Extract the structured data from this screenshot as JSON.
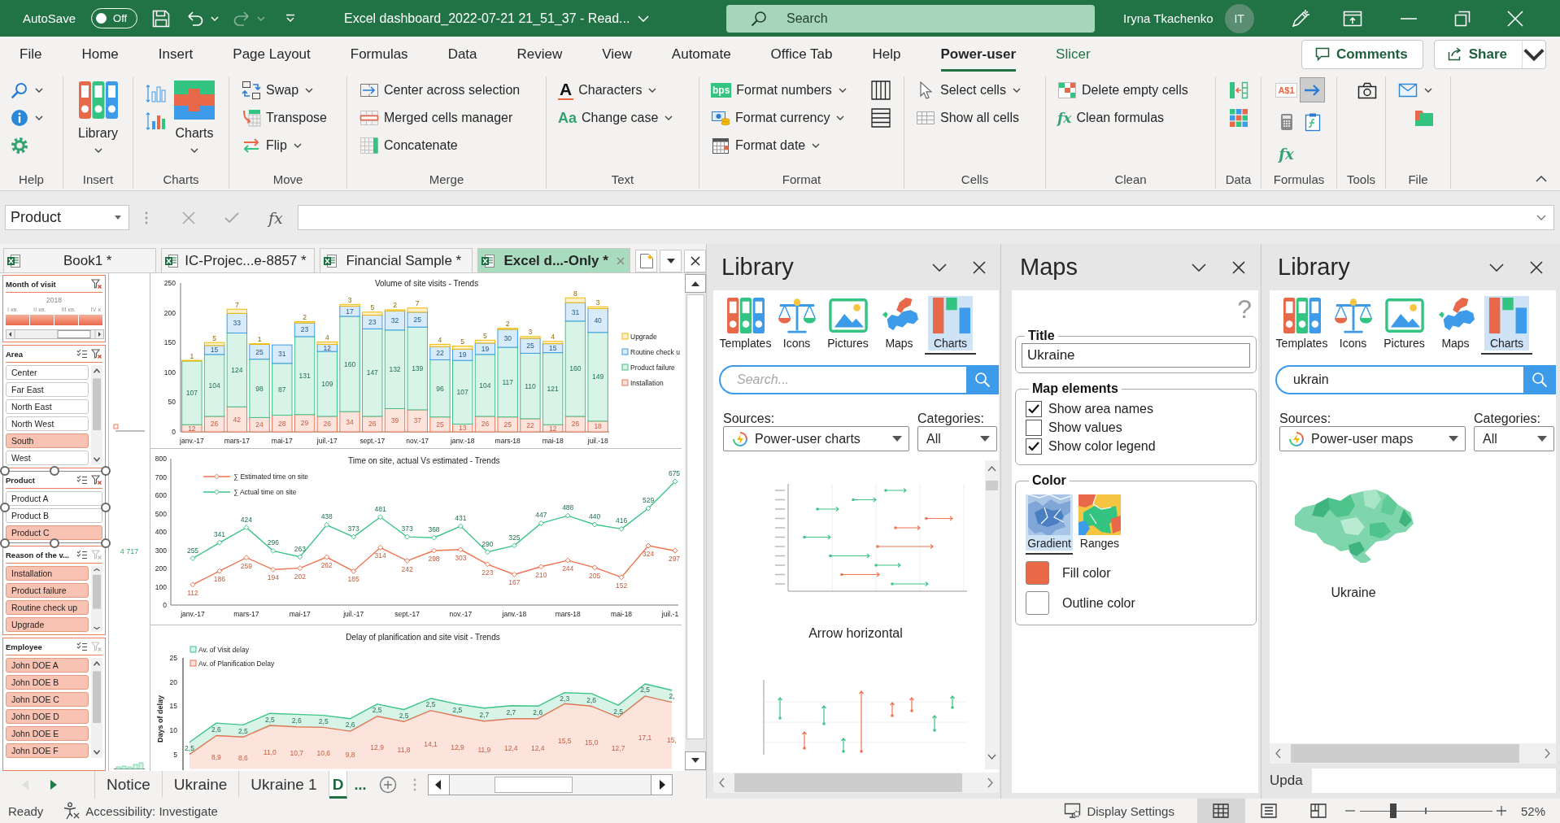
{
  "title_bar": {
    "autosave": {
      "label": "AutoSave",
      "state_label": "Off",
      "on": false
    },
    "redo": {
      "disabled": true
    },
    "document_title": "Excel dashboard_2022-07-21 21_51_37 - Read...",
    "search": {
      "placeholder": "Search"
    },
    "user": {
      "name": "Iryna Tkachenko",
      "initials": "IT"
    }
  },
  "ribbon": {
    "tabs": [
      {
        "label": "File",
        "selected": false,
        "kind": "tab"
      },
      {
        "label": "Home",
        "selected": false,
        "kind": "tab"
      },
      {
        "label": "Insert",
        "selected": false,
        "kind": "tab"
      },
      {
        "label": "Page Layout",
        "selected": false,
        "kind": "tab"
      },
      {
        "label": "Formulas",
        "selected": false,
        "kind": "tab"
      },
      {
        "label": "Data",
        "selected": false,
        "kind": "tab"
      },
      {
        "label": "Review",
        "selected": false,
        "kind": "tab"
      },
      {
        "label": "View",
        "selected": false,
        "kind": "tab"
      },
      {
        "label": "Automate",
        "selected": false,
        "kind": "tab"
      },
      {
        "label": "Office Tab",
        "selected": false,
        "kind": "tab"
      },
      {
        "label": "Help",
        "selected": false,
        "kind": "tab"
      },
      {
        "label": "Power-user",
        "selected": true,
        "kind": "tab"
      },
      {
        "label": "Slicer",
        "selected": false,
        "kind": "contextual"
      }
    ],
    "actions": [
      {
        "label": "Comments"
      },
      {
        "label": "Share"
      }
    ],
    "groups": [
      {
        "label": "Help"
      },
      {
        "label": "Insert",
        "buttons": [
          {
            "label": "Library"
          }
        ]
      },
      {
        "label": "Charts",
        "buttons": [
          {
            "label": "Charts"
          }
        ]
      },
      {
        "label": "Move",
        "buttons": [
          {
            "label": "Swap"
          },
          {
            "label": "Transpose"
          },
          {
            "label": "Flip"
          }
        ]
      },
      {
        "label": "Merge",
        "buttons": [
          {
            "label": "Center across selection"
          },
          {
            "label": "Merged cells manager"
          },
          {
            "label": "Concatenate"
          }
        ]
      },
      {
        "label": "Text",
        "buttons": [
          {
            "label": "Characters",
            "glyph": "A"
          },
          {
            "label": "Change case",
            "glyph": "Aa"
          }
        ]
      },
      {
        "label": "Format",
        "buttons": [
          {
            "label": "Format numbers",
            "glyph": "bps"
          },
          {
            "label": "Format currency"
          },
          {
            "label": "Format date"
          }
        ]
      },
      {
        "label": "Cells",
        "buttons": [
          {
            "label": "Select cells"
          },
          {
            "label": "Show all cells"
          }
        ]
      },
      {
        "label": "Clean",
        "buttons": [
          {
            "label": "Delete empty cells"
          },
          {
            "label": "Clean formulas",
            "glyph": "fx"
          }
        ]
      },
      {
        "label": "Data"
      },
      {
        "label": "Formulas",
        "buttons": [
          {
            "glyph": "A$1",
            "pressed": false
          },
          {
            "pressed": true
          },
          {
            "pressed": false
          },
          {
            "pressed": false
          },
          {
            "glyph": "fx",
            "pressed": false
          }
        ]
      },
      {
        "label": "Tools"
      },
      {
        "label": "File"
      }
    ]
  },
  "formula_bar": {
    "name_box": "Product",
    "fx": "fx"
  },
  "workbook_tabs": [
    {
      "label": "Book1 *",
      "selected": false
    },
    {
      "label": "IC-Projec...e-8857 *",
      "selected": false
    },
    {
      "label": "Financial Sample *",
      "selected": false
    },
    {
      "label": "Excel d...-Only *",
      "selected": true
    }
  ],
  "sheet": {
    "slicers": [
      {
        "kind": "timeline",
        "title": "Month of visit",
        "filtered": true,
        "selected": false,
        "year": "2018",
        "periods": [
          "I кв.",
          "II кв.",
          "III кв.",
          "IV к"
        ]
      },
      {
        "kind": "list",
        "title": "Area",
        "filtered": true,
        "selected": false,
        "items": [
          {
            "label": "Center",
            "selected": false
          },
          {
            "label": "Far East",
            "selected": false
          },
          {
            "label": "North East",
            "selected": false
          },
          {
            "label": "North West",
            "selected": false
          },
          {
            "label": "South",
            "selected": true
          },
          {
            "label": "West",
            "selected": false
          }
        ]
      },
      {
        "kind": "list",
        "title": "Product",
        "filtered": true,
        "selected": true,
        "items": [
          {
            "label": "Product A",
            "selected": false
          },
          {
            "label": "Product B",
            "selected": false
          },
          {
            "label": "Product C",
            "selected": true
          }
        ]
      },
      {
        "kind": "list",
        "title": "Reason of the v...",
        "filtered": false,
        "selected": false,
        "items": [
          {
            "label": "Installation",
            "selected": true
          },
          {
            "label": "Product failure",
            "selected": true
          },
          {
            "label": "Routine check up",
            "selected": true
          },
          {
            "label": "Upgrade",
            "selected": true
          }
        ]
      },
      {
        "kind": "list",
        "title": "Employee",
        "filtered": false,
        "selected": false,
        "items": [
          {
            "label": "John DOE A",
            "selected": true
          },
          {
            "label": "John DOE B",
            "selected": true
          },
          {
            "label": "John DOE C",
            "selected": true
          },
          {
            "label": "John DOE D",
            "selected": true
          },
          {
            "label": "John DOE E",
            "selected": true
          },
          {
            "label": "John DOE F",
            "selected": true
          }
        ]
      }
    ],
    "mini_label": "4 717",
    "charts": [
      {
        "chart_data": {
          "type": "bar",
          "stacked": true,
          "title": "Volume of site visits - Trends",
          "categories": [
            "janv.-17",
            null,
            "mars-17",
            null,
            "mai-17",
            null,
            "juil.-17",
            null,
            "sept.-17",
            null,
            "nov.-17",
            null,
            "janv.-18",
            null,
            "mars-18",
            null,
            "mai-18",
            null,
            "juil.-18"
          ],
          "ylim": [
            0,
            250
          ],
          "yticks": [
            0,
            50,
            100,
            150,
            200,
            250
          ],
          "data_labels": true,
          "legend": "right",
          "series": [
            {
              "name": "Installation",
              "color": "#ef7350",
              "values": [
                12,
                26,
                42,
                24,
                28,
                29,
                26,
                34,
                26,
                39,
                37,
                25,
                13,
                26,
                25,
                22,
                12,
                26,
                18
              ]
            },
            {
              "name": "Product failure",
              "color": "#3cc487",
              "values": [
                107,
                104,
                124,
                98,
                87,
                131,
                109,
                160,
                147,
                132,
                139,
                96,
                107,
                104,
                117,
                110,
                121,
                160,
                149
              ]
            },
            {
              "name": "Routine check u",
              "color": "#3d9be9",
              "values": [
                null,
                15,
                33,
                25,
                31,
                23,
                12,
                17,
                23,
                32,
                25,
                22,
                19,
                19,
                30,
                25,
                15,
                31,
                40
              ]
            },
            {
              "name": "Upgrade",
              "color": "#f5b800",
              "values": [
                1,
                5,
                7,
                1,
                null,
                2,
                4,
                3,
                5,
                2,
                7,
                4,
                5,
                5,
                2,
                3,
                4,
                8,
                3
              ]
            }
          ]
        }
      },
      {
        "chart_data": {
          "type": "line",
          "title": "Time on site, actual Vs estimated - Trends",
          "categories": [
            "janv.-17",
            null,
            "mars-17",
            null,
            "mai-17",
            null,
            "juil.-17",
            null,
            "sept.-17",
            null,
            "nov.-17",
            null,
            "janv.-18",
            null,
            "mars-18",
            null,
            "mai-18",
            null,
            "juil.-1"
          ],
          "ylim": [
            0,
            800
          ],
          "yticks": [
            0,
            100,
            200,
            300,
            400,
            500,
            600,
            700,
            800
          ],
          "data_labels": true,
          "legend": "top-left",
          "series": [
            {
              "name": "∑ Estimated time on site",
              "color": "#ef7350",
              "marker": "diamond",
              "values": [
                112,
                186,
                259,
                194,
                202,
                262,
                185,
                314,
                242,
                298,
                303,
                223,
                167,
                210,
                244,
                205,
                152,
                324,
                297
              ]
            },
            {
              "name": "∑ Actual time on site",
              "color": "#3cc487",
              "marker": "diamond",
              "values": [
                255,
                341,
                424,
                296,
                263,
                438,
                373,
                481,
                373,
                368,
                431,
                290,
                325,
                447,
                488,
                440,
                416,
                529,
                675
              ]
            }
          ]
        }
      },
      {
        "chart_data": {
          "type": "area",
          "stacked": true,
          "title": "Delay of planification and site visit - Trends",
          "ylabel": "Days of delay",
          "categories": [
            null,
            null,
            null,
            null,
            null,
            null,
            null,
            null,
            null,
            null,
            null,
            null,
            null,
            null,
            null,
            null,
            null,
            null,
            null
          ],
          "ylim": [
            2,
            25
          ],
          "yticks": [
            5,
            10,
            15,
            20,
            25
          ],
          "legend": "top-left",
          "series": [
            {
              "name": "Av. of Planification Delay",
              "color": "#ef7350",
              "values": [
                5.0,
                8.9,
                8.6,
                11.0,
                10.7,
                10.6,
                9.8,
                12.9,
                11.8,
                14.1,
                12.9,
                11.9,
                12.4,
                12.4,
                15.5,
                15.0,
                12.7,
                17.1,
                15.8
              ]
            },
            {
              "name": "Av. of Visit delay",
              "color": "#3cc487",
              "values": [
                2.5,
                2.6,
                2.5,
                2.5,
                2.6,
                2.5,
                2.6,
                2.5,
                2.5,
                2.5,
                2.5,
                2.7,
                2.7,
                2.6,
                2.3,
                2.6,
                2.5,
                2.5,
                2.5
              ]
            }
          ],
          "value_labels": [
            [
              null,
              "8,9",
              "8,6",
              "11,0",
              "10,7",
              "10,6",
              "9,8",
              "12,9",
              "11,8",
              "14,1",
              "12,9",
              "11,9",
              "12,4",
              "12,4",
              "15,5",
              "15,0",
              "12,7",
              "17,1",
              "15,"
            ],
            [
              "2,5",
              "2,6",
              "2,5",
              "2,5",
              "2,6",
              "2,5",
              "2,6",
              "2,5",
              "2,5",
              "2,5",
              "2,5",
              "2,7",
              "2,7",
              "2,6",
              "2,3",
              "2,6",
              "2,5",
              "2,5",
              "2,"
            ]
          ]
        }
      }
    ]
  },
  "sheet_tabs": {
    "nav": [
      {
        "disabled": true
      },
      {
        "disabled": false
      }
    ],
    "tabs": [
      {
        "label": "Notice",
        "selected": false
      },
      {
        "label": "Ukraine",
        "selected": false
      },
      {
        "label": "Ukraine 1",
        "selected": false
      },
      {
        "label": "D",
        "selected": true
      }
    ],
    "more": "..."
  },
  "panes": [
    {
      "kind": "library",
      "title": "Library",
      "categories": [
        {
          "label": "Templates",
          "selected": false
        },
        {
          "label": "Icons",
          "selected": false
        },
        {
          "label": "Pictures",
          "selected": false
        },
        {
          "label": "Maps",
          "selected": false
        },
        {
          "label": "Charts",
          "selected": true
        }
      ],
      "search": {
        "placeholder": "Search..."
      },
      "sources_label": "Sources:",
      "source": "Power-user charts",
      "categories_label": "Categories:",
      "category": "All",
      "results": [
        {
          "kind": "arrow-horizontal",
          "caption": "Arrow horizontal"
        },
        {
          "kind": "arrow-vertical"
        }
      ]
    },
    {
      "kind": "maps",
      "title": "Maps",
      "help": "?",
      "title_group": {
        "legend": "Title",
        "value": "Ukraine"
      },
      "elements_group": {
        "legend": "Map elements",
        "options": [
          {
            "label": "Show area names",
            "checked": true
          },
          {
            "label": "Show values",
            "checked": false
          },
          {
            "label": "Show color legend",
            "checked": true
          }
        ]
      },
      "color_group": {
        "legend": "Color",
        "modes": [
          {
            "label": "Gradient",
            "selected": true
          },
          {
            "label": "Ranges",
            "selected": false
          }
        ],
        "swatches": [
          {
            "label": "Fill color",
            "color": "#ea6a47"
          },
          {
            "label": "Outline color",
            "color": "#ffffff"
          }
        ]
      }
    },
    {
      "kind": "library",
      "title": "Library",
      "categories": [
        {
          "label": "Templates",
          "selected": false
        },
        {
          "label": "Icons",
          "selected": false
        },
        {
          "label": "Pictures",
          "selected": false
        },
        {
          "label": "Maps",
          "selected": false
        },
        {
          "label": "Charts",
          "selected": true
        }
      ],
      "search": {
        "value": "ukrain"
      },
      "sources_label": "Sources:",
      "source": "Power-user maps",
      "categories_label": "Categories:",
      "category": "All",
      "results": [
        {
          "kind": "map",
          "caption": "Ukraine"
        }
      ],
      "footer_label": "Upda"
    }
  ],
  "status_bar": {
    "status": "Ready",
    "accessibility": "Accessibility: Investigate",
    "display_settings": "Display Settings",
    "views": [
      {
        "selected": true
      },
      {
        "selected": false
      },
      {
        "selected": false
      }
    ],
    "zoom": {
      "level": 0.25,
      "label": "52%"
    }
  }
}
